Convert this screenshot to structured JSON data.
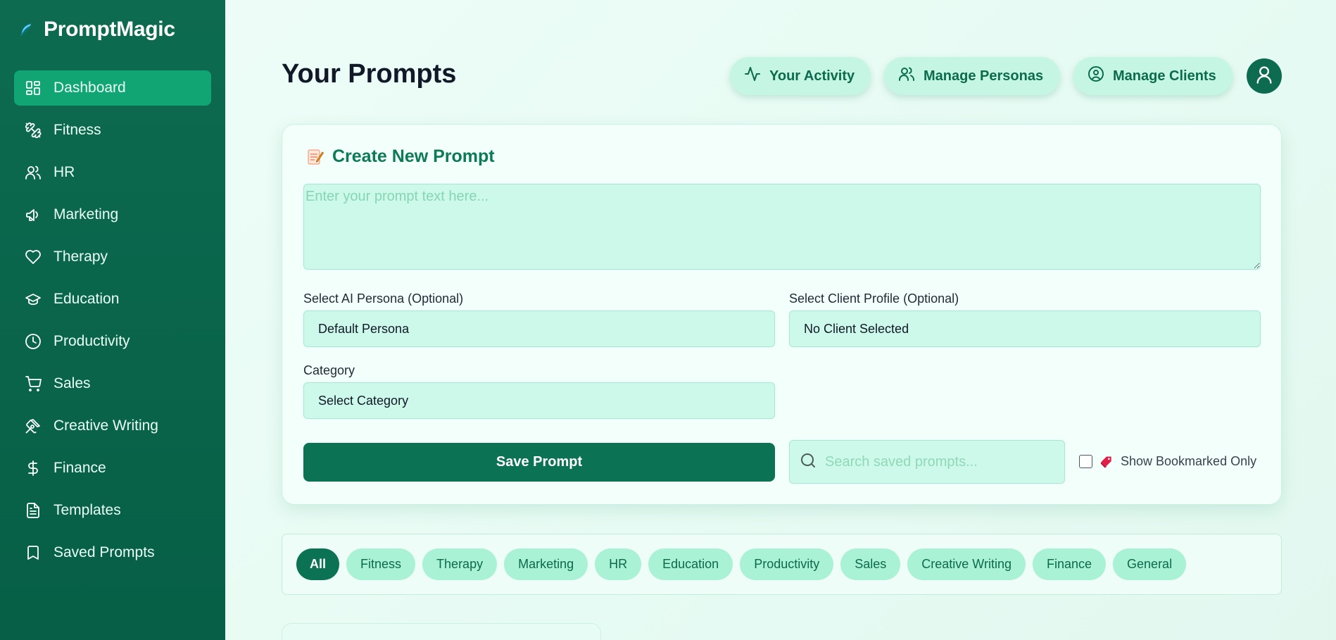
{
  "brand": {
    "name": "PromptMagic",
    "logo_icon": "feather-icon"
  },
  "sidebar": {
    "items": [
      {
        "label": "Dashboard",
        "icon": "dashboard-icon",
        "active": true
      },
      {
        "label": "Fitness",
        "icon": "dumbbell-icon",
        "active": false
      },
      {
        "label": "HR",
        "icon": "users-icon",
        "active": false
      },
      {
        "label": "Marketing",
        "icon": "megaphone-icon",
        "active": false
      },
      {
        "label": "Therapy",
        "icon": "heart-icon",
        "active": false
      },
      {
        "label": "Education",
        "icon": "graduation-cap-icon",
        "active": false
      },
      {
        "label": "Productivity",
        "icon": "clock-icon",
        "active": false
      },
      {
        "label": "Sales",
        "icon": "cart-icon",
        "active": false
      },
      {
        "label": "Creative Writing",
        "icon": "pen-nib-icon",
        "active": false
      },
      {
        "label": "Finance",
        "icon": "dollar-icon",
        "active": false
      },
      {
        "label": "Templates",
        "icon": "document-icon",
        "active": false
      },
      {
        "label": "Saved Prompts",
        "icon": "bookmark-icon",
        "active": false
      }
    ]
  },
  "header": {
    "title": "Your Prompts",
    "activity_label": "Your Activity",
    "personas_label": "Manage Personas",
    "clients_label": "Manage Clients"
  },
  "create_form": {
    "title": "Create New Prompt",
    "prompt_value": "",
    "prompt_placeholder": "Enter your prompt text here...",
    "persona_label": "Select AI Persona (Optional)",
    "persona_value": "Default Persona",
    "client_label": "Select Client Profile (Optional)",
    "client_value": "No Client Selected",
    "category_label": "Category",
    "category_value": "Select Category",
    "save_label": "Save Prompt",
    "search_placeholder": "Search saved prompts...",
    "bookmark_label": "Show Bookmarked Only",
    "bookmark_checked": false
  },
  "filters": {
    "chips": [
      "All",
      "Fitness",
      "Therapy",
      "Marketing",
      "HR",
      "Education",
      "Productivity",
      "Sales",
      "Creative Writing",
      "Finance",
      "General"
    ],
    "active": "All"
  },
  "colors": {
    "sidebar": "#0d6b4f",
    "accent": "#10a572",
    "primary_button": "#0b7253",
    "input_bg": "#cdf9ea",
    "chip_bg": "#a9f2d5",
    "title_green": "#0b7a55"
  }
}
